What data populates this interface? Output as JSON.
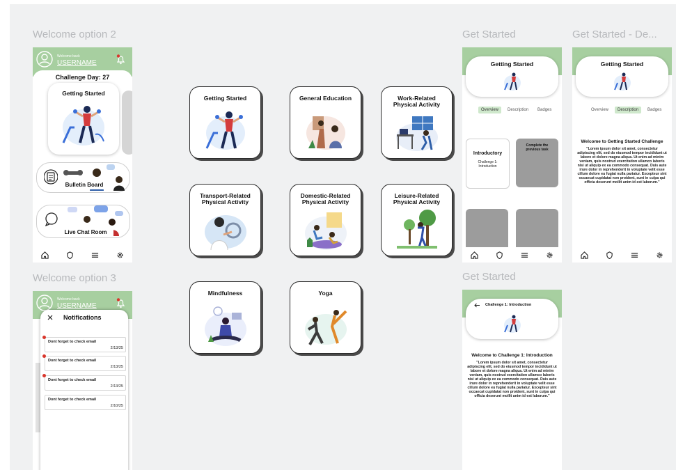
{
  "frames": {
    "welcome2": "Welcome option 2",
    "welcome3": "Welcome option 3",
    "get_started_1": "Get Started",
    "get_started_desc": "Get Started - De...",
    "get_started_2": "Get Started"
  },
  "welcome2": {
    "greeting": "Welcome back",
    "username": "USERNAME",
    "challenge_day": "Challenge Day: 27",
    "getting_started": "Getting Started",
    "bulletin_board": "Bulletin Board",
    "live_chat": "Live Chat Room"
  },
  "welcome3": {
    "greeting": "Welcome back",
    "username": "USERNAME",
    "panel_title": "Notifications",
    "notifications": [
      {
        "text": "Dont forget to check email",
        "date": "2/13/25"
      },
      {
        "text": "Dont forget to check email",
        "date": "2/13/25"
      },
      {
        "text": "Dont forget to check email",
        "date": "2/13/25"
      },
      {
        "text": "Dont forget to check email",
        "date": "2/10/25"
      }
    ]
  },
  "categories": [
    "Getting Started",
    "General Education",
    "Work-Related Physical Activity",
    "Transport-Related Physical Activity",
    "Domestic-Related Physical Activity",
    "Leisure-Related Physical Activity",
    "Mindfulness",
    "Yoga"
  ],
  "get_started_overview": {
    "title": "Getting Started",
    "tabs": [
      "Overview",
      "Description",
      "Badges"
    ],
    "active_tab": "Overview",
    "card1_title": "Introductory",
    "card1_sub": "Challenge 1: Introduction",
    "card2_text": "Complete the previous task"
  },
  "get_started_description": {
    "title": "Getting Started",
    "tabs": [
      "Overview",
      "Description",
      "Badges"
    ],
    "active_tab": "Description",
    "heading": "Welcome to Getting Started Challenge",
    "body": "\"Lorem ipsum dolor sit amet, consectetur adipiscing elit, sed do eiusmod tempor incididunt ut labore et dolore magna aliqua. Ut enim ad minim veniam, quis nostrud exercitation ullamco laboris nisi ut aliquip ex ea commodo consequat. Duis aute irure dolor in reprehenderit in voluptate velit esse cillum dolore eu fugiat nulla pariatur. Excepteur sint occaecat cupidatat non proident, sunt in culpa qui officia deserunt mollit anim id est laborum.\""
  },
  "challenge_intro": {
    "header": "Challenge 1: Introduction",
    "heading": "Welcome to Challenge 1: Introduction",
    "body": "\"Lorem ipsum dolor sit amet, consectetur adipiscing elit, sed do eiusmod tempor incididunt ut labore et dolore magna aliqua. Ut enim ad minim veniam, quis nostrud exercitation ullamco laboris nisi ut aliquip ex ea commodo consequat. Duis aute irure dolor in reprehenderit in voluptate velit esse cillum dolore eu fugiat nulla pariatur. Excepteur sint occaecat cupidatat non proident, sunt in culpa qui officia deserunt mollit anim id est laborum.\""
  },
  "icons": [
    "user-circle-icon",
    "bell-icon",
    "home-icon",
    "shield-icon",
    "menu-icon",
    "gear-icon",
    "close-icon",
    "back-arrow-icon",
    "clipboard-icon",
    "chat-bubble-icon"
  ],
  "colors": {
    "header_green": "#a7cfa0",
    "tab_active": "#cfe8cc",
    "notif_dot": "#d9362c",
    "locked_card": "#9c9c9c"
  }
}
